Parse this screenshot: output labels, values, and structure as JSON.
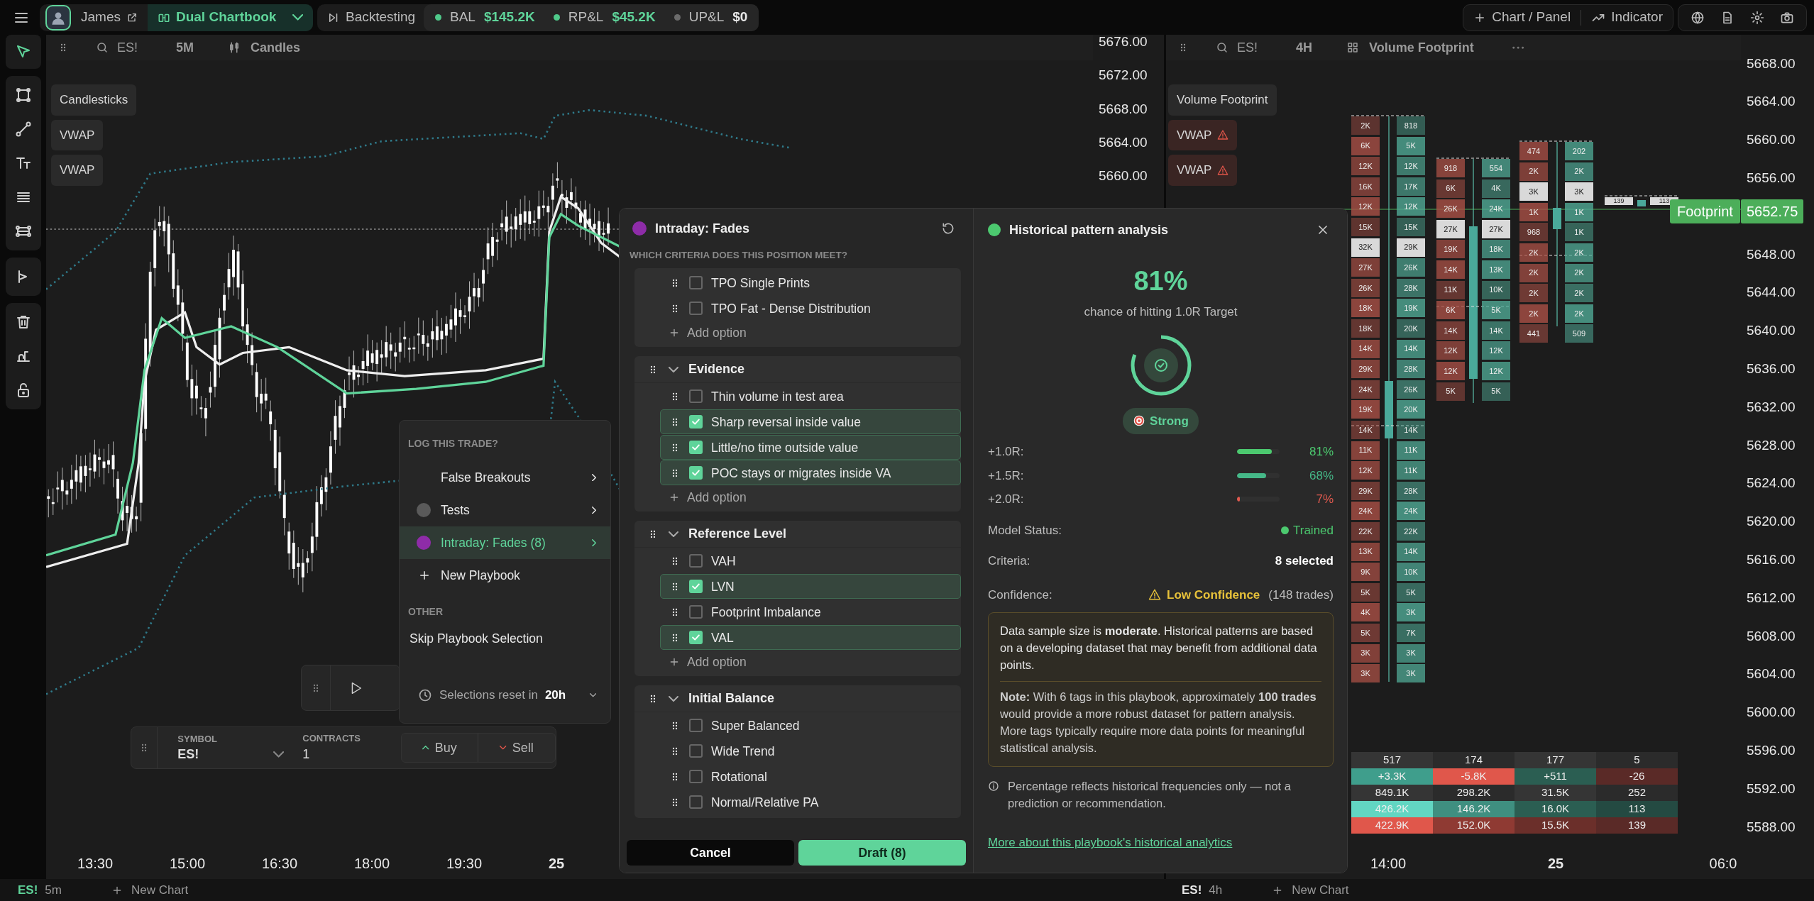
{
  "top_bar": {
    "user": "James",
    "chartbook": "Dual Chartbook",
    "mode": "Backtesting",
    "stats": [
      {
        "label": "BAL",
        "value": "$145.2K",
        "color": "#4fc98a",
        "kind": "gain"
      },
      {
        "label": "RP&L",
        "value": "$45.2K",
        "color": "#4fc98a",
        "kind": "gain"
      },
      {
        "label": "UP&L",
        "value": "$0",
        "color": "#6b6b6b",
        "kind": "flat"
      }
    ],
    "actions": [
      "Chart / Panel",
      "Indicator"
    ]
  },
  "toolbar": {
    "groups": [
      {
        "tools": [
          {
            "kind": "cursor",
            "selected": true
          }
        ]
      },
      {
        "tools": [
          {
            "kind": "select",
            "selected": false
          },
          {
            "kind": "line",
            "selected": false
          },
          {
            "kind": "text",
            "selected": false
          },
          {
            "kind": "lines",
            "selected": false
          },
          {
            "kind": "pattern",
            "selected": false
          }
        ]
      },
      {
        "tools": [
          {
            "kind": "replay",
            "selected": false
          }
        ]
      },
      {
        "tools": [
          {
            "kind": "trash",
            "selected": false
          },
          {
            "kind": "measure",
            "selected": false
          },
          {
            "kind": "lock",
            "selected": false
          }
        ]
      }
    ]
  },
  "left_chart": {
    "symbol": "ES!",
    "interval": "5M",
    "style": "Candles",
    "legend": [
      {
        "label": "Candlesticks",
        "warning": false
      },
      {
        "label": "VWAP",
        "warning": false
      },
      {
        "label": "VWAP",
        "warning": false
      }
    ],
    "price_axis": [
      "5676.00",
      "5672.00",
      "5668.00",
      "5664.00",
      "5660.00"
    ],
    "time_axis": [
      {
        "label": "13:30",
        "bold": false
      },
      {
        "label": "15:00",
        "bold": false
      },
      {
        "label": "16:30",
        "bold": false
      },
      {
        "label": "18:00",
        "bold": false
      },
      {
        "label": "19:30",
        "bold": false
      },
      {
        "label": "25",
        "bold": true
      }
    ],
    "tab": {
      "symbol": "ES!",
      "interval": "5m",
      "new_label": "New Chart"
    }
  },
  "right_chart": {
    "symbol": "ES!",
    "interval": "4H",
    "style": "Volume Footprint",
    "legend": [
      {
        "label": "Volume Footprint",
        "warning": false
      },
      {
        "label": "VWAP",
        "warning": true
      },
      {
        "label": "VWAP",
        "warning": true
      }
    ],
    "price_axis": [
      "5668.00",
      "5664.00",
      "5660.00",
      "5656.00",
      "5648.00",
      "5644.00",
      "5640.00",
      "5636.00",
      "5632.00",
      "5628.00",
      "5624.00",
      "5620.00",
      "5616.00",
      "5612.00",
      "5608.00",
      "5604.00",
      "5600.00",
      "5596.00",
      "5592.00",
      "5588.00"
    ],
    "last_price": {
      "label": "Footprint",
      "price": "5652.75"
    },
    "footprint_bars": [
      {
        "rows": [
          {
            "bid": "2K",
            "ask": "818",
            "highlight": false
          },
          {
            "bid": "6K",
            "ask": "5K",
            "highlight": false
          },
          {
            "bid": "12K",
            "ask": "12K",
            "highlight": false
          },
          {
            "bid": "16K",
            "ask": "17K",
            "highlight": false
          },
          {
            "bid": "12K",
            "ask": "12K",
            "highlight": false
          },
          {
            "bid": "15K",
            "ask": "15K",
            "highlight": false
          },
          {
            "bid": "32K",
            "ask": "29K",
            "highlight": true
          },
          {
            "bid": "27K",
            "ask": "26K",
            "highlight": false
          },
          {
            "bid": "26K",
            "ask": "28K",
            "highlight": false
          },
          {
            "bid": "18K",
            "ask": "19K",
            "highlight": false
          },
          {
            "bid": "18K",
            "ask": "20K",
            "highlight": false
          },
          {
            "bid": "14K",
            "ask": "14K",
            "highlight": false
          },
          {
            "bid": "29K",
            "ask": "28K",
            "highlight": false
          },
          {
            "bid": "24K",
            "ask": "26K",
            "highlight": false
          },
          {
            "bid": "19K",
            "ask": "20K",
            "highlight": false
          },
          {
            "bid": "14K",
            "ask": "14K",
            "highlight": false
          },
          {
            "bid": "11K",
            "ask": "11K",
            "highlight": false
          },
          {
            "bid": "12K",
            "ask": "11K",
            "highlight": false
          },
          {
            "bid": "29K",
            "ask": "28K",
            "highlight": false
          },
          {
            "bid": "24K",
            "ask": "24K",
            "highlight": false
          },
          {
            "bid": "22K",
            "ask": "22K",
            "highlight": false
          },
          {
            "bid": "13K",
            "ask": "14K",
            "highlight": false
          },
          {
            "bid": "9K",
            "ask": "10K",
            "highlight": false
          },
          {
            "bid": "5K",
            "ask": "5K",
            "highlight": false
          },
          {
            "bid": "4K",
            "ask": "3K",
            "highlight": false
          },
          {
            "bid": "5K",
            "ask": "7K",
            "highlight": false
          },
          {
            "bid": "3K",
            "ask": "3K",
            "highlight": false
          },
          {
            "bid": "3K",
            "ask": "3K",
            "highlight": false
          }
        ]
      },
      {
        "rows": [
          {
            "bid": "918",
            "ask": "554",
            "highlight": false
          },
          {
            "bid": "6K",
            "ask": "4K",
            "highlight": false
          },
          {
            "bid": "26K",
            "ask": "24K",
            "highlight": false
          },
          {
            "bid": "27K",
            "ask": "27K",
            "highlight": true
          },
          {
            "bid": "19K",
            "ask": "18K",
            "highlight": false
          },
          {
            "bid": "14K",
            "ask": "13K",
            "highlight": false
          },
          {
            "bid": "11K",
            "ask": "10K",
            "highlight": false
          },
          {
            "bid": "6K",
            "ask": "5K",
            "highlight": false
          },
          {
            "bid": "14K",
            "ask": "14K",
            "highlight": false
          },
          {
            "bid": "12K",
            "ask": "12K",
            "highlight": false
          },
          {
            "bid": "12K",
            "ask": "12K",
            "highlight": false
          },
          {
            "bid": "5K",
            "ask": "5K",
            "highlight": false
          }
        ]
      },
      {
        "rows": [
          {
            "bid": "474",
            "ask": "202",
            "highlight": false
          },
          {
            "bid": "2K",
            "ask": "2K",
            "highlight": false
          },
          {
            "bid": "3K",
            "ask": "3K",
            "highlight": true
          },
          {
            "bid": "1K",
            "ask": "1K",
            "highlight": false
          },
          {
            "bid": "968",
            "ask": "1K",
            "highlight": false
          },
          {
            "bid": "2K",
            "ask": "2K",
            "highlight": false
          },
          {
            "bid": "2K",
            "ask": "2K",
            "highlight": false
          },
          {
            "bid": "2K",
            "ask": "2K",
            "highlight": false
          },
          {
            "bid": "2K",
            "ask": "2K",
            "highlight": false
          },
          {
            "bid": "441",
            "ask": "509",
            "highlight": false
          }
        ]
      },
      {
        "rows": [
          {
            "bid": "139",
            "ask": "113",
            "highlight": true
          }
        ]
      }
    ],
    "summary": [
      [
        {
          "text": "517",
          "color": "#353535"
        },
        {
          "text": "174",
          "color": "#2b2b2b"
        },
        {
          "text": "177",
          "color": "#353535"
        },
        {
          "text": "5",
          "color": "#2b2b2b"
        }
      ],
      [
        {
          "text": "+3.3K",
          "color": "#3f9e8c"
        },
        {
          "text": "-5.8K",
          "color": "#e0574b"
        },
        {
          "text": "+511",
          "color": "#2b5e52"
        },
        {
          "text": "-26",
          "color": "#5a2a27"
        }
      ],
      [
        {
          "text": "849.1K",
          "color": "#353535"
        },
        {
          "text": "298.2K",
          "color": "#2b2b2b"
        },
        {
          "text": "31.5K",
          "color": "#353535"
        },
        {
          "text": "252",
          "color": "#2b2b2b"
        }
      ],
      [
        {
          "text": "426.2K",
          "color": "#62d6c2"
        },
        {
          "text": "146.2K",
          "color": "#3f8f80"
        },
        {
          "text": "16.0K",
          "color": "#2b5e52"
        },
        {
          "text": "113",
          "color": "#244a42"
        }
      ],
      [
        {
          "text": "422.9K",
          "color": "#e0574b"
        },
        {
          "text": "152.0K",
          "color": "#8f3a33"
        },
        {
          "text": "15.5K",
          "color": "#6b2f2a"
        },
        {
          "text": "139",
          "color": "#5a2a27"
        }
      ]
    ],
    "time_axis": [
      {
        "label": "14:00",
        "bold": false
      },
      {
        "label": "25",
        "bold": true
      },
      {
        "label": "06:0",
        "bold": false
      }
    ],
    "tab": {
      "symbol": "ES!",
      "interval": "4h",
      "new_label": "New Chart"
    }
  },
  "log_popup": {
    "title": "LOG THIS TRADE?",
    "playbooks": [
      {
        "label": "False Breakouts",
        "selected": false
      },
      {
        "label": "Tests",
        "color": "#5a5a5a",
        "selected": false
      },
      {
        "label": "Intraday: Fades",
        "count": "(8)",
        "color": "#8e2ca8",
        "selected": true
      }
    ],
    "new_label": "New Playbook",
    "other_title": "OTHER",
    "skip_label": "Skip Playbook Selection",
    "reset": {
      "label": "Selections reset in",
      "value": "20h"
    }
  },
  "trade_bar": {
    "symbol_label": "SYMBOL",
    "symbol": "ES!",
    "contracts_label": "CONTRACTS",
    "contracts": "1",
    "buttons": [
      {
        "label": "Buy",
        "kind": "buy"
      },
      {
        "label": "Sell",
        "kind": "sell"
      }
    ]
  },
  "criteria_panel": {
    "title": "Intraday: Fades",
    "color": "#8e2ca8",
    "question": "WHICH CRITERIA DOES THIS POSITION MEET?",
    "groups": [
      {
        "items": [
          {
            "label": "TPO Single Prints",
            "checked": false
          },
          {
            "label": "TPO Fat - Dense Distribution",
            "checked": false
          }
        ],
        "add_label": "Add option"
      },
      {
        "title": "Evidence",
        "expanded": true,
        "items": [
          {
            "label": "Thin volume in test area",
            "checked": false
          },
          {
            "label": "Sharp reversal inside value",
            "checked": true
          },
          {
            "label": "Little/no time outside value",
            "checked": true
          },
          {
            "label": "POC stays or migrates inside VA",
            "checked": true
          }
        ],
        "add_label": "Add option"
      },
      {
        "title": "Reference Level",
        "expanded": true,
        "items": [
          {
            "label": "VAH",
            "checked": false
          },
          {
            "label": "LVN",
            "checked": true
          },
          {
            "label": "Footprint Imbalance",
            "checked": false
          },
          {
            "label": "VAL",
            "checked": true
          }
        ],
        "add_label": "Add option"
      },
      {
        "title": "Initial Balance",
        "expanded": true,
        "items": [
          {
            "label": "Super Balanced",
            "checked": false
          },
          {
            "label": "Wide Trend",
            "checked": false
          },
          {
            "label": "Rotational",
            "checked": false
          },
          {
            "label": "Normal/Relative PA",
            "checked": false
          }
        ]
      }
    ],
    "buttons": [
      {
        "label": "Cancel",
        "kind": "cancel"
      },
      {
        "label": "Draft (8)",
        "kind": "primary"
      }
    ]
  },
  "analysis_panel": {
    "title": "Historical pattern analysis",
    "color": "#4cc96f",
    "percent": "81%",
    "subtitle": "chance of hitting 1.0R Target",
    "gauge": {
      "level": 0.81
    },
    "strength": "Strong",
    "targets": [
      {
        "label": "+1.0R:",
        "value": "81%",
        "level": 0.81,
        "color": "#4cc96f"
      },
      {
        "label": "+1.5R:",
        "value": "68%",
        "level": 0.68,
        "color": "#45b888"
      },
      {
        "label": "+2.0R:",
        "value": "7%",
        "level": 0.07,
        "color": "#e05a4f"
      }
    ],
    "model_status": {
      "label": "Model Status:",
      "value": "Trained",
      "color": "#4cc96f"
    },
    "criteria": {
      "label": "Criteria:",
      "value": "8 selected"
    },
    "confidence": {
      "label": "Confidence:",
      "value": "Low Confidence",
      "trades": "(148 trades)"
    },
    "note": [
      "Data sample size is **moderate**. Historical patterns are based on a developing dataset that may benefit from additional data points.",
      "**Note:** With 6 tags in this playbook, approximately **100 trades** would provide a more robust dataset for pattern analysis. More tags typically require more data points for meaningful statistical analysis."
    ],
    "disclaimer": "Percentage reflects historical frequencies only — not a prediction or recommendation.",
    "link": "More about this playbook's historical analytics"
  }
}
